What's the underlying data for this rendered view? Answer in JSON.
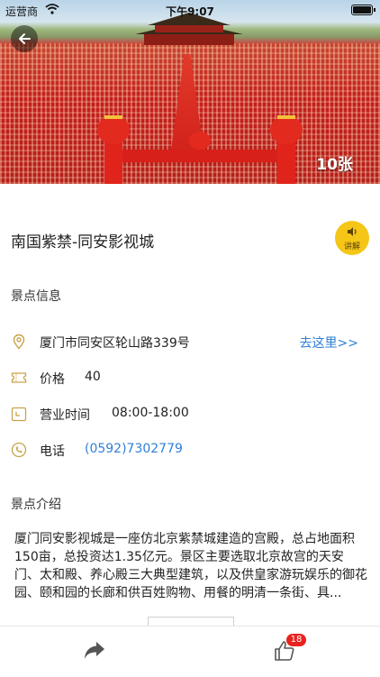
{
  "status_bar": {
    "carrier": "运营商",
    "time": "下午9:07"
  },
  "gallery": {
    "photo_count": "10张"
  },
  "attraction": {
    "name": "南国紫禁-同安影视城",
    "audio_guide_label": "讲解"
  },
  "info_section": {
    "heading": "景点信息",
    "address": "厦门市同安区轮山路339号",
    "route_link": "去这里>>",
    "price_label": "价格",
    "price_value": "40",
    "hours_label": "营业时间",
    "hours_value": "08:00-18:00",
    "phone_label": "电话",
    "phone_value": "(0592)7302779"
  },
  "intro_section": {
    "heading": "景点介绍",
    "text": "厦门同安影视城是一座仿北京紫禁城建造的宫殿，总占地面积150亩，总投资达1.35亿元。景区主要选取北京故宫的天安门、太和殿、养心殿三大典型建筑，以及供皇家游玩娱乐的御花园、颐和园的长廊和供百姓购物、用餐的明清一条街、具..."
  },
  "bottom_bar": {
    "like_count": "18"
  },
  "colors": {
    "accent_yellow": "#f5c518",
    "link_blue": "#2f7fd6",
    "badge_red": "#e8231f",
    "icon_gold": "#c9a24a"
  }
}
